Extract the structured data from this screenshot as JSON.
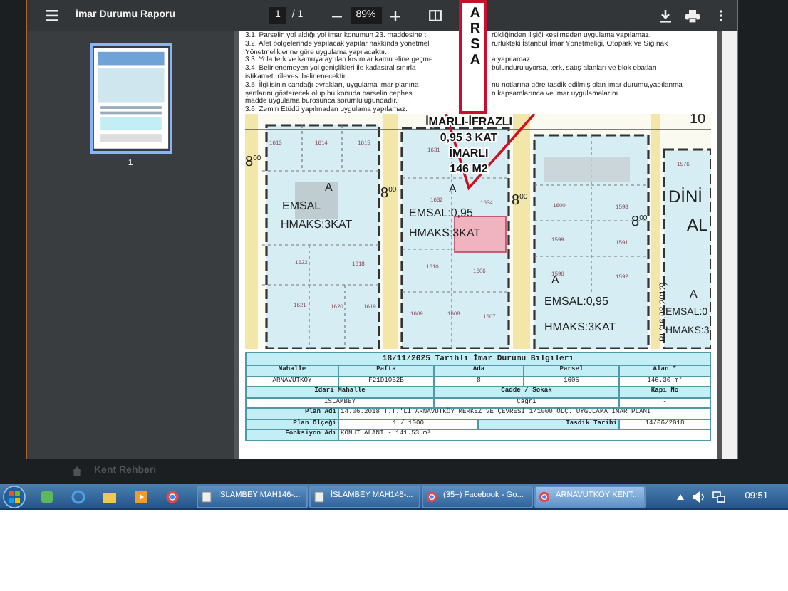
{
  "viewer": {
    "title": "İmar Durumu Raporu",
    "page_input": "1",
    "page_of": "/ 1",
    "zoom": "89%"
  },
  "sidebar": {
    "thumbnails": [
      {
        "label": "1",
        "selected": true
      }
    ]
  },
  "document": {
    "stamp": "ARSA",
    "notes": [
      {
        "left": "3.1. Parselin yol aldığı yol imar konumun 23. maddesine t",
        "right": "rükliğinden ilişiği kesilmeden uygulama yapılamaz."
      },
      {
        "left": "3.2. Afet bölgelerinde yapılacak yapılar hakkında yönetmel",
        "right": "rürlükteki İstanbul İmar Yönetmeliği, Otopark ve Sığınak"
      },
      {
        "left": "Yönetmeliklerine göre uygulama yapılacaktır."
      },
      {
        "left": "3.3. Yola terk ve kamuya ayrılan kısımlar kamu eline geçme",
        "right": "a yapılamaz."
      },
      {
        "left": "3.4. Belirlenemeyen yol genişlikleri ile kadastral sınırla",
        "right": "bulunduruluyorsa, terk, satış alanları ve blok ebatları"
      },
      {
        "left": "istikamet rölevesi belirlenecektir."
      },
      {
        "left": "3.5. İlgilisinin candağı evrakları, uygulama imar planına",
        "right": "nu notlarına göre tasdik edilmiş olan imar durumu,yapılanma"
      },
      {
        "left": "şartlarını gösterecek olup bu konuda parselin cephesi,",
        "right": "n kapsamlarınca ve imar uygulamalarını"
      },
      {
        "left": "madde uygulama bürosunca sorumluluğundadır."
      },
      {
        "left": "3.6. Zemin Etüdü yapılmadan uygulama yapılamaz."
      }
    ],
    "map": {
      "annotation": [
        "İMARLI-İFRAZLI",
        "0,95 3 KAT",
        "İMARLI",
        "146 M2"
      ],
      "labels": [
        {
          "text": "1613",
          "kind": "parcel"
        },
        {
          "text": "1614",
          "kind": "parcel"
        },
        {
          "text": "1615",
          "kind": "parcel"
        },
        {
          "text": "1631",
          "kind": "parcel"
        },
        {
          "text": "1632",
          "kind": "parcel"
        },
        {
          "text": "1634",
          "kind": "parcel"
        },
        {
          "text": "1610",
          "kind": "parcel"
        },
        {
          "text": "1606",
          "kind": "parcel"
        },
        {
          "text": "1609",
          "kind": "parcel"
        },
        {
          "text": "1608",
          "kind": "parcel"
        },
        {
          "text": "1607",
          "kind": "parcel"
        },
        {
          "text": "1600",
          "kind": "parcel"
        },
        {
          "text": "1598",
          "kind": "parcel"
        },
        {
          "text": "1599",
          "kind": "parcel"
        },
        {
          "text": "1591",
          "kind": "parcel"
        },
        {
          "text": "1596",
          "kind": "parcel"
        },
        {
          "text": "1592",
          "kind": "parcel"
        },
        {
          "text": "1622",
          "kind": "parcel"
        },
        {
          "text": "1618",
          "kind": "parcel"
        },
        {
          "text": "1621",
          "kind": "parcel"
        },
        {
          "text": "1620",
          "kind": "parcel"
        },
        {
          "text": "1619",
          "kind": "parcel"
        },
        {
          "text": "1576",
          "kind": "parcel"
        },
        {
          "text": "A",
          "kind": "zone"
        },
        {
          "text": "EMSAL",
          "kind": "zone"
        },
        {
          "text": "HMAKS:3KAT",
          "kind": "zone"
        },
        {
          "text": "A",
          "kind": "zone"
        },
        {
          "text": "EMSAL:0,95",
          "kind": "zone"
        },
        {
          "text": "HMAKS:3KAT",
          "kind": "zone"
        },
        {
          "text": "A",
          "kind": "zone"
        },
        {
          "text": "EMSAL:0,95",
          "kind": "zone"
        },
        {
          "text": "HMAKS:3KAT",
          "kind": "zone"
        },
        {
          "text": "DİNİ",
          "kind": "area"
        },
        {
          "text": "AL",
          "kind": "area"
        },
        {
          "text": "A",
          "kind": "zone"
        },
        {
          "text": "EMSAL:0",
          "kind": "zone"
        },
        {
          "text": "HMAKS:3",
          "kind": "zone"
        },
        {
          "text": "8$^{00}$",
          "kind": "elevation"
        },
        {
          "text": "8$^{00}$",
          "kind": "elevation"
        },
        {
          "text": "8$^{00}$",
          "kind": "elevation"
        },
        {
          "text": "8$^{00}$",
          "kind": "elevation"
        },
        {
          "text": "10",
          "kind": "elevation"
        },
        {
          "text": "RI (16.08.2012)",
          "kind": "road"
        }
      ]
    },
    "table": {
      "title": "18/11/2025 Tarihli İmar Durumu Bilgileri",
      "sections": [
        {
          "rows": [
            [
              {
                "text": "Mahalle",
                "kind": "head"
              },
              {
                "text": "Pafta",
                "kind": "head"
              },
              {
                "text": "Ada",
                "kind": "head"
              },
              {
                "text": "Parsel",
                "kind": "head"
              },
              {
                "text": "Alan *",
                "kind": "head"
              }
            ],
            [
              {
                "text": "ARNAVUTKÖY",
                "kind": "value"
              },
              {
                "text": "F21D10B2B",
                "kind": "value"
              },
              {
                "text": "8",
                "kind": "value"
              },
              {
                "text": "1605",
                "kind": "value"
              },
              {
                "text": "146.30 m²",
                "kind": "value"
              }
            ]
          ]
        },
        {
          "rows": [
            [
              {
                "text": "İdari Mahalle",
                "kind": "head"
              },
              {
                "text": "Cadde / Sokak",
                "kind": "head"
              },
              {
                "text": "Kapı No",
                "kind": "head"
              }
            ],
            [
              {
                "text": "İSLAMBEY",
                "kind": "value"
              },
              {
                "text": "Çağrı",
                "kind": "value"
              },
              {
                "text": "-",
                "kind": "value"
              }
            ]
          ]
        },
        {
          "rows": [
            [
              {
                "text": "Plan Adı",
                "kind": "label"
              },
              {
                "text": "14.06.2018 T.T.'Lİ ARNAVUTKÖY MERKEZ VE ÇEVRESİ 1/1000 ÖLÇ. UYGULAMA İMAR PLANI",
                "kind": "text"
              }
            ]
          ]
        },
        {
          "rows": [
            [
              {
                "text": "Plan Ölçeği",
                "kind": "label"
              },
              {
                "text": "1 / 1000",
                "kind": "value"
              },
              {
                "text": "Tasdik Tarihi",
                "kind": "label"
              },
              {
                "text": "14/06/2018",
                "kind": "value"
              }
            ]
          ]
        },
        {
          "rows": [
            [
              {
                "text": "Fonksiyon Adı",
                "kind": "label"
              },
              {
                "text": "KONUT ALANI  - 141.53 m²",
                "kind": "text"
              }
            ]
          ]
        }
      ]
    }
  },
  "background_app": {
    "label": "Kent Rehberi"
  },
  "taskbar": {
    "tasks": [
      {
        "label": "İSLAMBEY MAH146-...",
        "kind": "document",
        "selected": false
      },
      {
        "label": "İSLAMBEY MAH146-...",
        "kind": "document",
        "selected": false
      },
      {
        "label": "(35+) Facebook - Go...",
        "kind": "browser",
        "selected": false
      },
      {
        "label": "ARNAVUTKÖY KENT...",
        "kind": "browser",
        "selected": true
      }
    ],
    "clock": "09:51"
  }
}
